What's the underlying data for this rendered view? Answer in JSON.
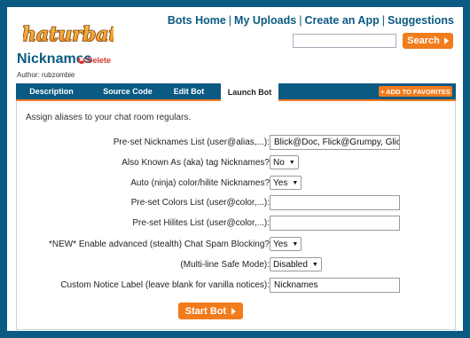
{
  "brand": {
    "logo_text": "Chaturbate"
  },
  "nav": {
    "links": [
      "Bots Home",
      "My Uploads",
      "Create an App",
      "Suggestions"
    ]
  },
  "search": {
    "placeholder": "",
    "button_label": "Search"
  },
  "page": {
    "title": "Nicknames",
    "delete_label": "Delete",
    "author": "Author: rubzombie"
  },
  "tabs": [
    "Description",
    "Source Code",
    "Edit Bot",
    "Launch Bot"
  ],
  "active_tab": "Launch Bot",
  "favorites_label": "+ ADD TO FAVORITES",
  "intro": "Assign aliases to your chat room regulars.",
  "fields": [
    {
      "label": "Pre-set Nicknames List (user@alias,...):",
      "type": "text",
      "value": "Blick@Doc, Flick@Grumpy, Glick@Ha"
    },
    {
      "label": "Also Known As (aka) tag Nicknames?",
      "type": "select",
      "value": "No"
    },
    {
      "label": "Auto (ninja) color/hilite Nicknames?",
      "type": "select",
      "value": "Yes"
    },
    {
      "label": "Pre-set Colors List (user@color,...):",
      "type": "text",
      "value": ""
    },
    {
      "label": "Pre-set Hilites List (user@color,...):",
      "type": "text",
      "value": ""
    },
    {
      "label": "*NEW* Enable advanced (stealth) Chat Spam Blocking?",
      "type": "select",
      "value": "Yes"
    },
    {
      "label": "(Multi-line Safe Mode):",
      "type": "select",
      "value": "Disabled"
    },
    {
      "label": "Custom Notice Label (leave blank for vanilla notices):",
      "type": "text",
      "value": "Nicknames"
    }
  ],
  "start_button_label": "Start Bot"
}
